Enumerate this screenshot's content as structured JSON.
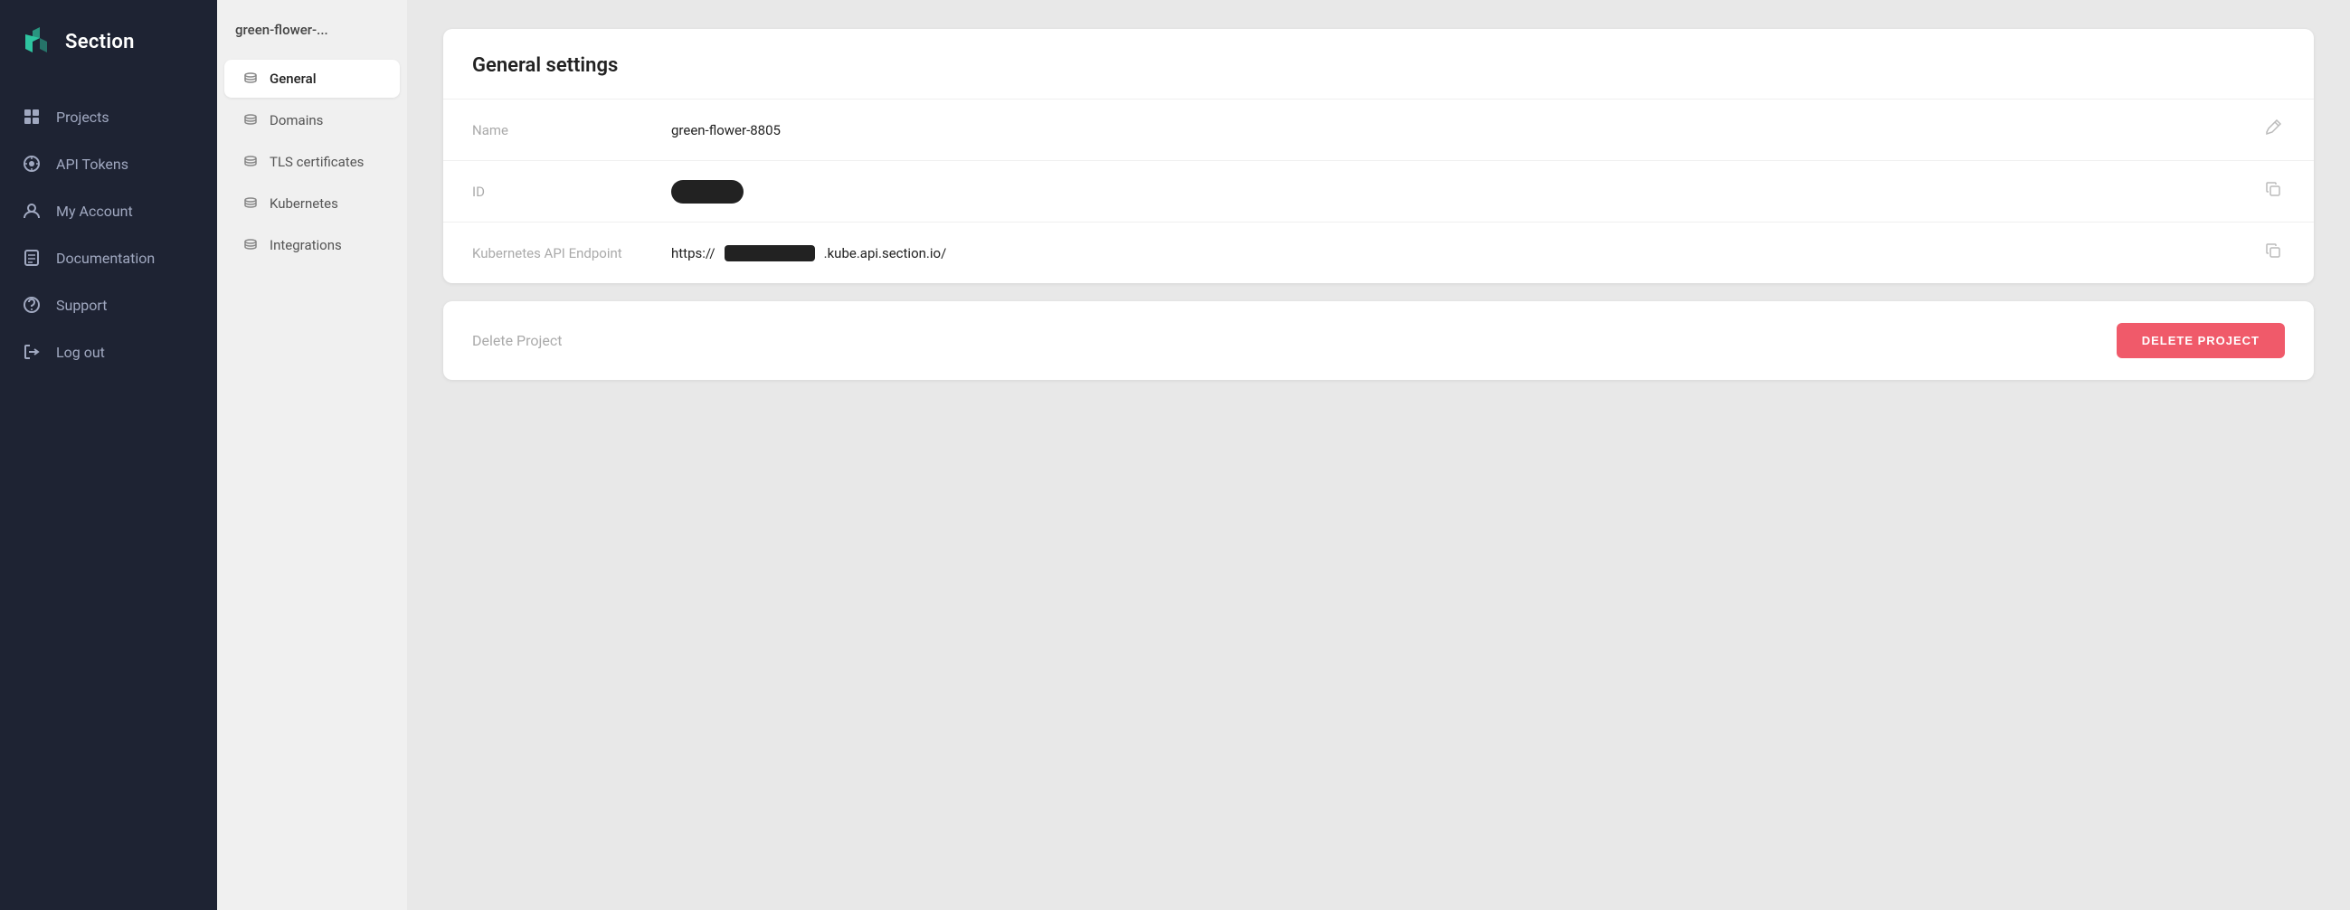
{
  "sidebar": {
    "logo_text": "Section",
    "items": [
      {
        "id": "projects",
        "label": "Projects"
      },
      {
        "id": "api-tokens",
        "label": "API Tokens"
      },
      {
        "id": "my-account",
        "label": "My Account"
      },
      {
        "id": "documentation",
        "label": "Documentation"
      },
      {
        "id": "support",
        "label": "Support"
      },
      {
        "id": "log-out",
        "label": "Log out"
      }
    ]
  },
  "secondary_sidebar": {
    "breadcrumb": "green-flower-...",
    "items": [
      {
        "id": "general",
        "label": "General",
        "active": true
      },
      {
        "id": "domains",
        "label": "Domains",
        "active": false
      },
      {
        "id": "tls-certificates",
        "label": "TLS certificates",
        "active": false
      },
      {
        "id": "kubernetes",
        "label": "Kubernetes",
        "active": false
      },
      {
        "id": "integrations",
        "label": "Integrations",
        "active": false
      }
    ]
  },
  "general_settings": {
    "title": "General settings",
    "fields": [
      {
        "id": "name",
        "label": "Name",
        "value": "green-flower-8805",
        "type": "text"
      },
      {
        "id": "id",
        "label": "ID",
        "value": "",
        "type": "redacted-pill"
      },
      {
        "id": "k8s-endpoint",
        "label": "Kubernetes API Endpoint",
        "value_prefix": "https://",
        "value_redacted": true,
        "value_suffix": ".kube.api.section.io/",
        "type": "redacted-inline"
      }
    ],
    "delete_section": {
      "label": "Delete Project",
      "button_label": "DELETE PROJECT"
    }
  }
}
